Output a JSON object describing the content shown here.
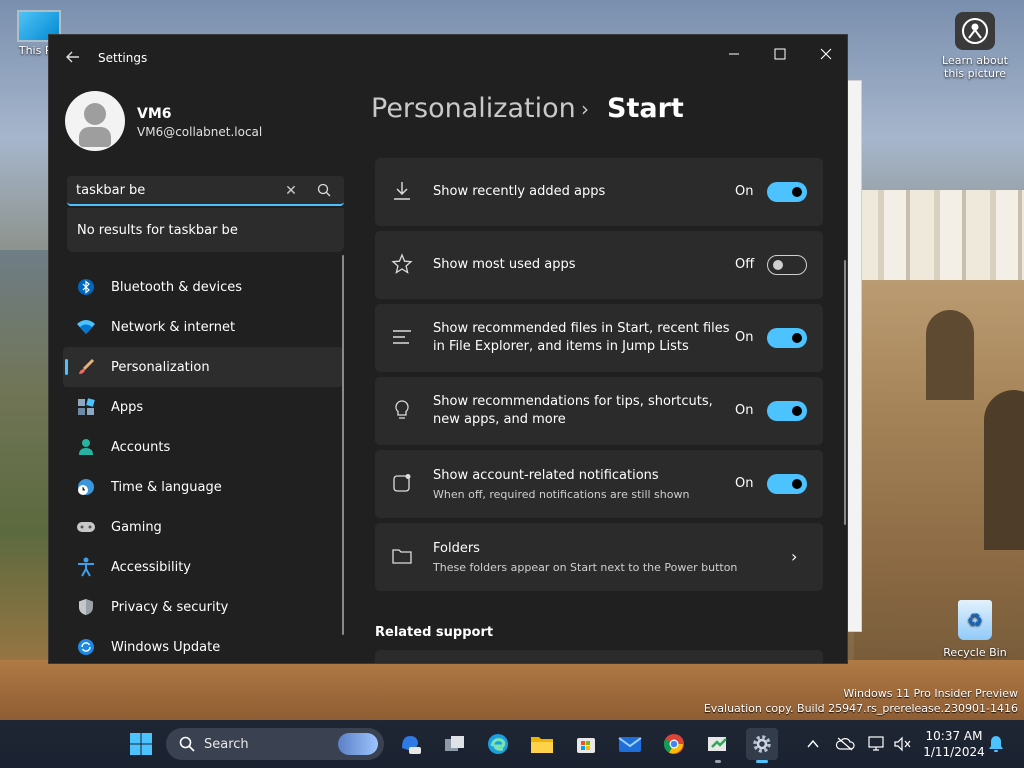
{
  "desktop": {
    "pc_label": "This PC",
    "learn_label_1": "Learn about",
    "learn_label_2": "this picture",
    "recycle_label": "Recycle Bin",
    "watermark_1": "Windows 11 Pro Insider Preview",
    "watermark_2": "Evaluation copy. Build 25947.rs_prerelease.230901-1416"
  },
  "window": {
    "title": "Settings",
    "minimize_icon": "minimize-icon",
    "maximize_icon": "maximize-icon",
    "close_icon": "close-icon"
  },
  "user": {
    "name": "VM6",
    "email": "VM6@collabnet.local"
  },
  "search": {
    "value": "taskbar be",
    "no_results": "No results for taskbar be"
  },
  "nav": {
    "items": [
      {
        "label": "Bluetooth & devices",
        "icon": "bluetooth-icon"
      },
      {
        "label": "Network & internet",
        "icon": "wifi-icon"
      },
      {
        "label": "Personalization",
        "icon": "brush-icon",
        "active": true
      },
      {
        "label": "Apps",
        "icon": "apps-icon"
      },
      {
        "label": "Accounts",
        "icon": "person-icon"
      },
      {
        "label": "Time & language",
        "icon": "globe-clock-icon"
      },
      {
        "label": "Gaming",
        "icon": "gamepad-icon"
      },
      {
        "label": "Accessibility",
        "icon": "accessibility-icon"
      },
      {
        "label": "Privacy & security",
        "icon": "shield-icon"
      },
      {
        "label": "Windows Update",
        "icon": "update-icon"
      }
    ]
  },
  "header": {
    "parent": "Personalization",
    "separator": "›",
    "current": "Start"
  },
  "settings": [
    {
      "title": "Show recently added apps",
      "state": "On",
      "on": true,
      "icon": "download-icon"
    },
    {
      "title": "Show most used apps",
      "state": "Off",
      "on": false,
      "icon": "star-icon"
    },
    {
      "title_1": "Show recommended files in Start, recent files",
      "title_2": "in File Explorer, and items in Jump Lists",
      "state": "On",
      "on": true,
      "icon": "list-icon"
    },
    {
      "title_1": "Show recommendations for tips, shortcuts,",
      "title_2": "new apps, and more",
      "state": "On",
      "on": true,
      "icon": "lightbulb-icon"
    },
    {
      "title": "Show account-related notifications",
      "subtitle": "When off, required notifications are still shown",
      "state": "On",
      "on": true,
      "icon": "notification-icon"
    },
    {
      "title": "Folders",
      "subtitle": "These folders appear on Start next to the Power button",
      "icon": "folder-icon"
    }
  ],
  "related": {
    "heading": "Related support"
  },
  "taskbar": {
    "search_label": "Search",
    "time": "10:37 AM",
    "date": "1/11/2024"
  },
  "colors": {
    "accent": "#4cc2ff",
    "window_bg": "#202020",
    "card_bg": "#2b2b2b"
  }
}
